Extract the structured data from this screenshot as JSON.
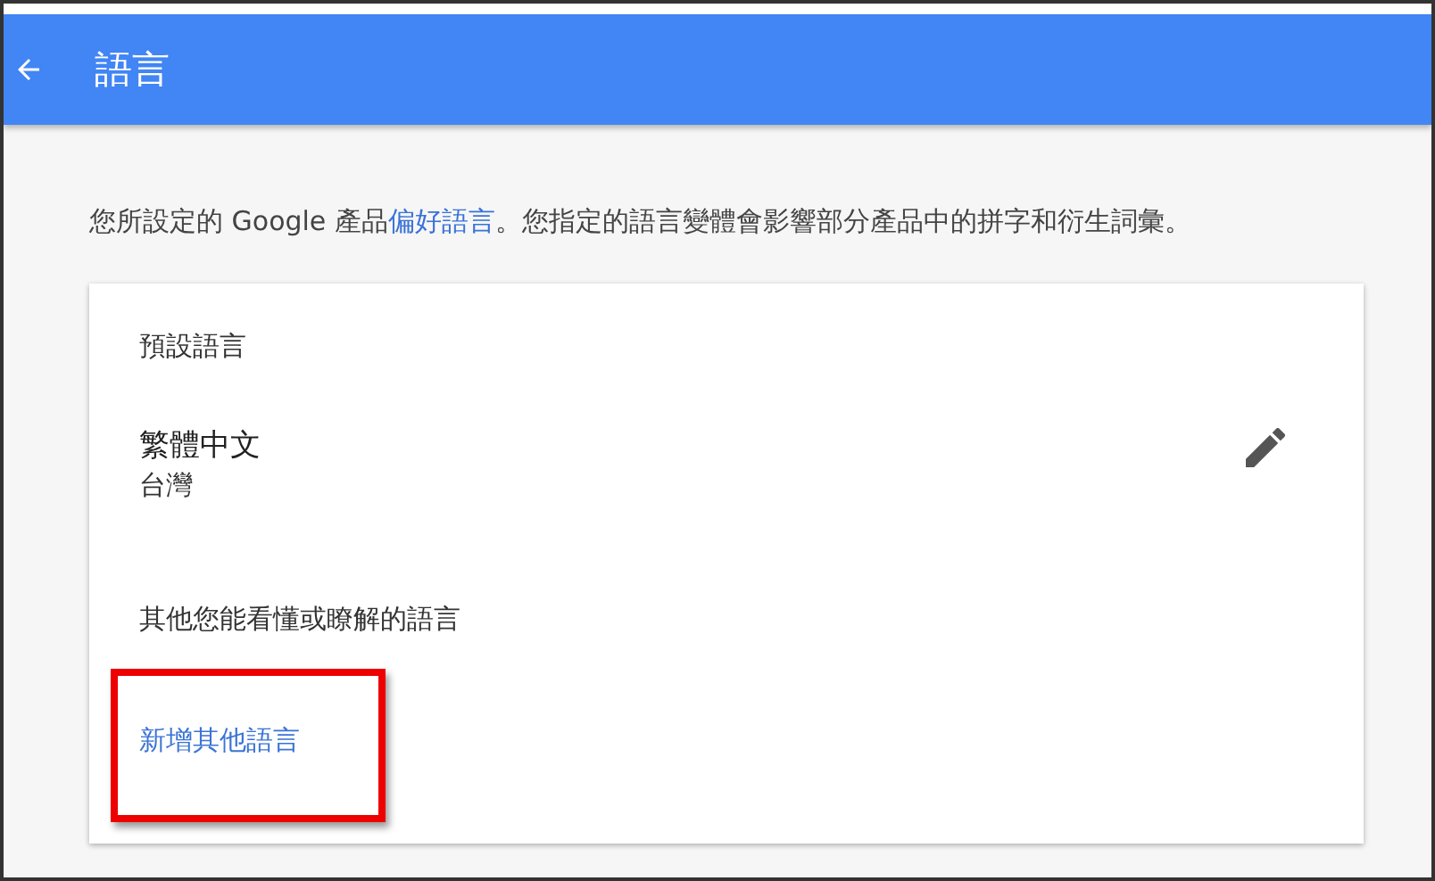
{
  "app_bar": {
    "title": "語言"
  },
  "intro": {
    "before": "您所設定的 Google 產品",
    "link": "偏好語言",
    "after": "。您指定的語言變體會影響部分產品中的拼字和衍生詞彙。"
  },
  "card": {
    "default_heading": "預設語言",
    "default_language": {
      "name": "繁體中文",
      "region": "台灣"
    },
    "other_heading": "其他您能看懂或瞭解的語言",
    "add_link": {
      "label": "新增其他語言",
      "highlighted": true
    }
  }
}
